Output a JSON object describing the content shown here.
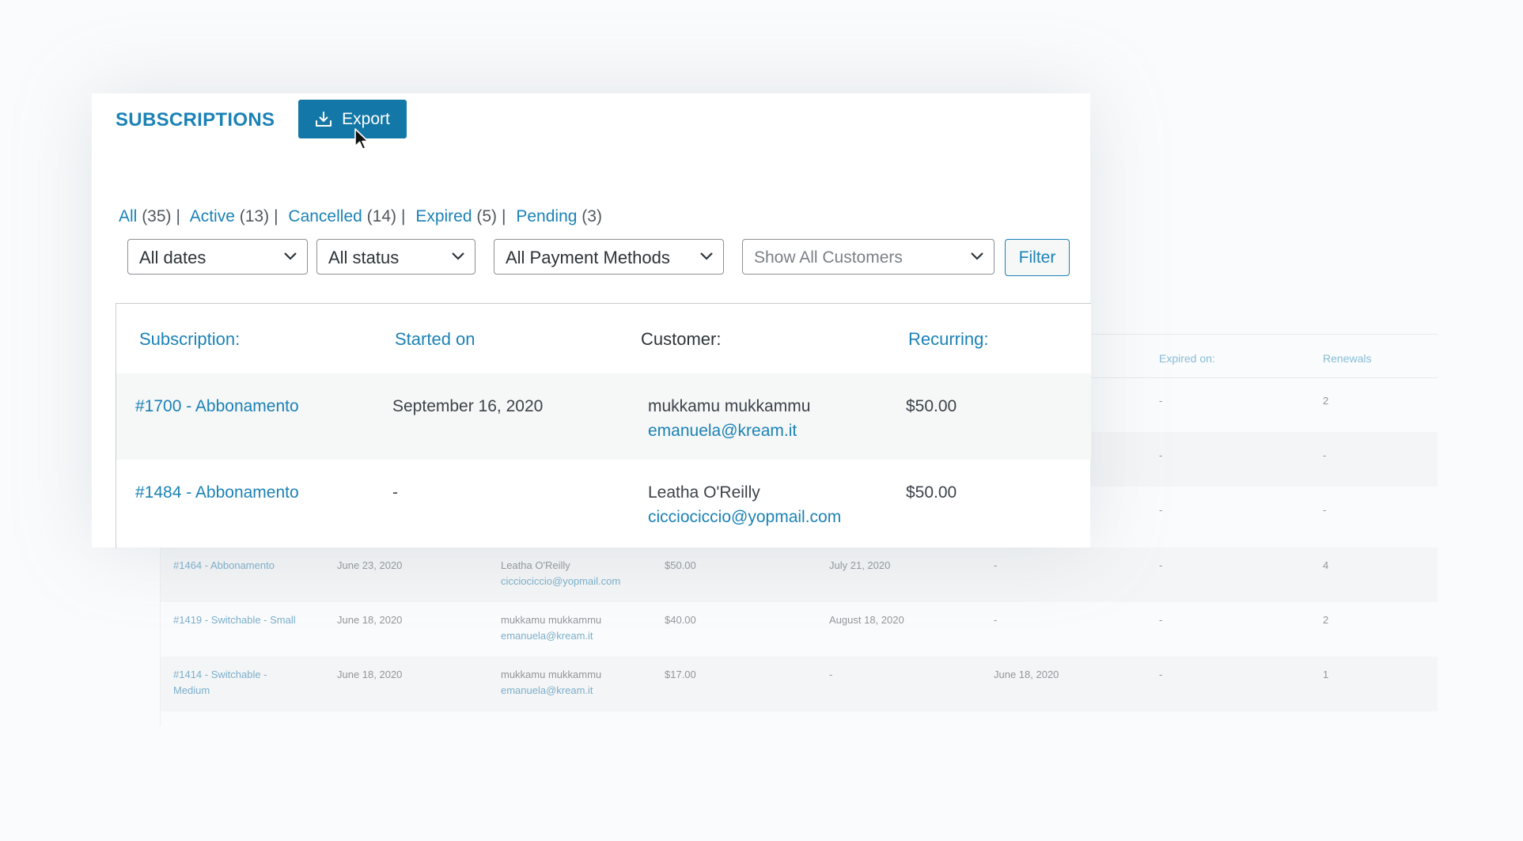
{
  "background_table": {
    "headers": {
      "expired_on": "Expired on:",
      "renewals": "Renewals"
    },
    "partial_rows": [
      {
        "expired": "-",
        "renewals": "2"
      },
      {
        "expired": "-",
        "renewals": "-"
      },
      {
        "expired": "-",
        "renewals": "-"
      }
    ],
    "rows": [
      {
        "subscription": "#1464 - Abbonamento",
        "started": "June 23, 2020",
        "name": "Leatha O'Reilly",
        "email": "cicciociccio@yopmail.com",
        "recurring": "$50.00",
        "col5": "July 21, 2020",
        "col6": "-",
        "expired": "-",
        "renewals": "4"
      },
      {
        "subscription": "#1419 - Switchable - Small",
        "started": "June 18, 2020",
        "name": "mukkamu mukkammu",
        "email": "emanuela@kream.it",
        "recurring": "$40.00",
        "col5": "August 18, 2020",
        "col6": "-",
        "expired": "-",
        "renewals": "2"
      },
      {
        "subscription_line1": "#1414 - Switchable -",
        "subscription_line2": "Medium",
        "started": "June 18, 2020",
        "name": "mukkamu mukkammu",
        "email": "emanuela@kream.it",
        "recurring": "$17.00",
        "col5": "-",
        "col6": "June 18, 2020",
        "expired": "-",
        "renewals": "1"
      }
    ]
  },
  "header": {
    "title": "SUBSCRIPTIONS",
    "export_label": "Export",
    "export_icon": "download-icon"
  },
  "status_filters": [
    {
      "label": "All",
      "count": "(35)"
    },
    {
      "label": "Active",
      "count": "(13)"
    },
    {
      "label": "Cancelled",
      "count": "(14)"
    },
    {
      "label": "Expired",
      "count": "(5)"
    },
    {
      "label": "Pending",
      "count": "(3)"
    }
  ],
  "filters": {
    "dates": "All dates",
    "status": "All status",
    "payment": "All Payment Methods",
    "customers_placeholder": "Show All Customers",
    "filter_button": "Filter"
  },
  "table": {
    "columns": {
      "subscription": "Subscription:",
      "started_on": "Started on",
      "customer": "Customer:",
      "recurring": "Recurring:"
    },
    "rows": [
      {
        "subscription": "#1700 - Abbonamento",
        "started_on": "September 16, 2020",
        "customer_name": "mukkamu mukkammu",
        "customer_email": "emanuela@kream.it",
        "recurring": "$50.00"
      },
      {
        "subscription": "#1484 - Abbonamento",
        "started_on": "-",
        "customer_name": "Leatha O'Reilly",
        "customer_email": "cicciociccio@yopmail.com",
        "recurring": "$50.00"
      }
    ]
  },
  "colors": {
    "accent": "#1b82b6",
    "button": "#1377a7"
  }
}
